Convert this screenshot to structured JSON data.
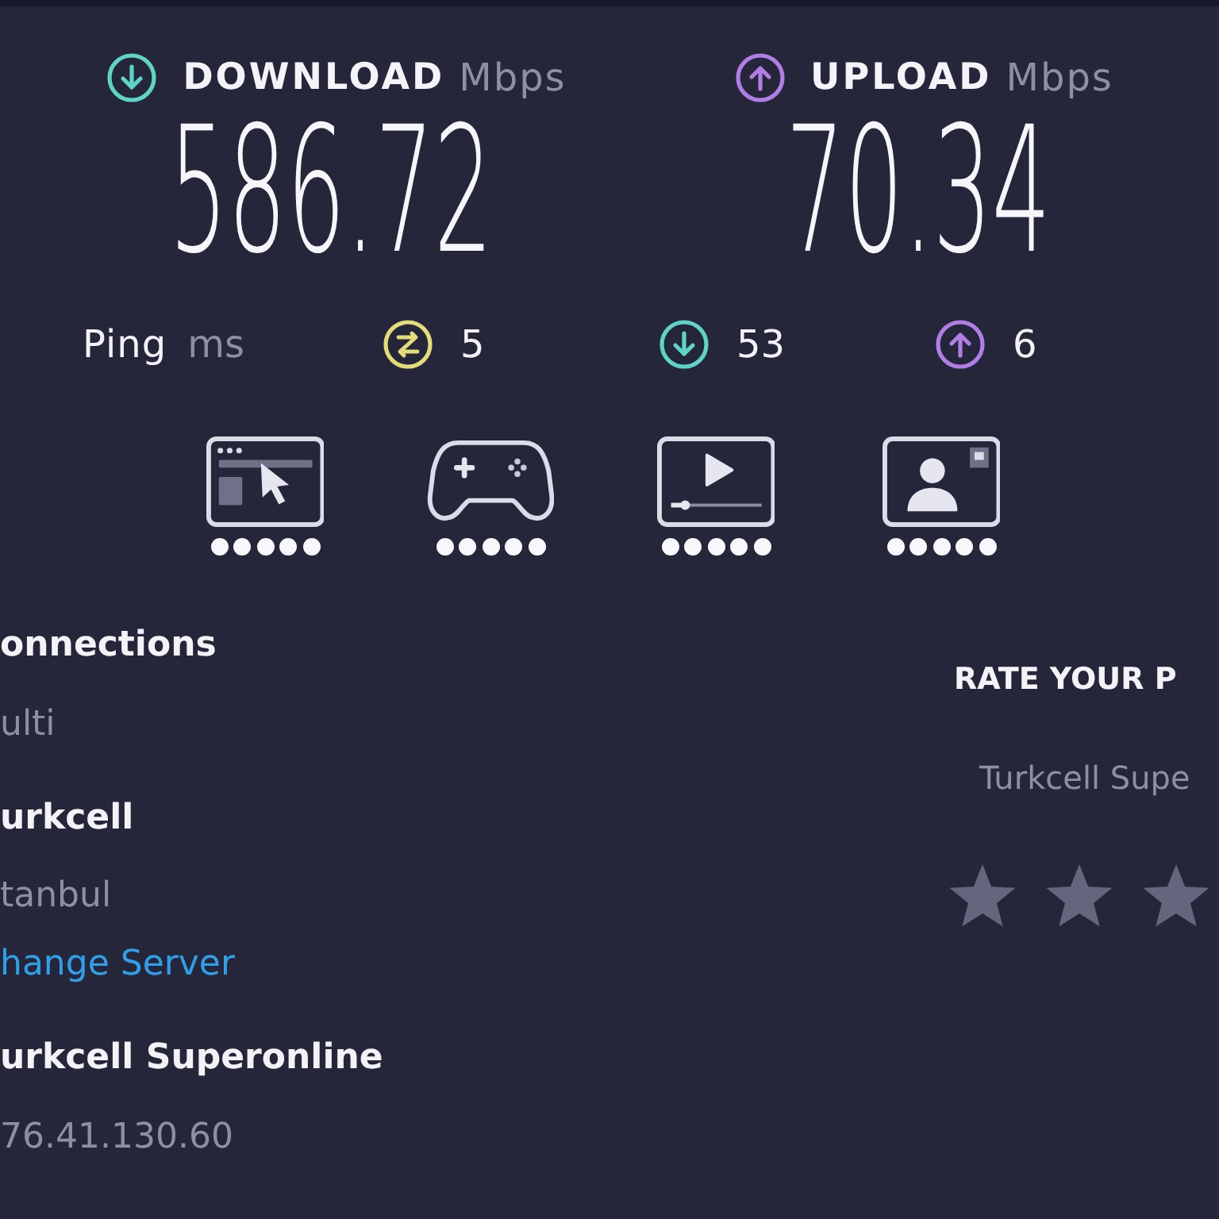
{
  "results": [
    {
      "kind": "download",
      "label": "DOWNLOAD",
      "unit": "Mbps",
      "value": "586.72"
    },
    {
      "kind": "upload",
      "label": "UPLOAD",
      "unit": "Mbps",
      "value": "70.34"
    }
  ],
  "ping": {
    "label": "Ping",
    "unit": "ms",
    "metrics": [
      {
        "kind": "idle",
        "value": "5"
      },
      {
        "kind": "download",
        "value": "53"
      },
      {
        "kind": "upload",
        "value": "6"
      }
    ]
  },
  "activities": [
    {
      "kind": "browsing",
      "stars": 5
    },
    {
      "kind": "gaming",
      "stars": 5
    },
    {
      "kind": "streaming",
      "stars": 5
    },
    {
      "kind": "video_call",
      "stars": 5
    }
  ],
  "connections": {
    "label": "onnections",
    "value": "ulti"
  },
  "server": {
    "name": "urkcell",
    "location": "tanbul",
    "link": "hange Server"
  },
  "provider": {
    "name": "urkcell Superonline",
    "ip": "76.41.130.60"
  },
  "rating": {
    "title": "RATE YOUR P",
    "provider": "Turkcell Supe"
  }
}
